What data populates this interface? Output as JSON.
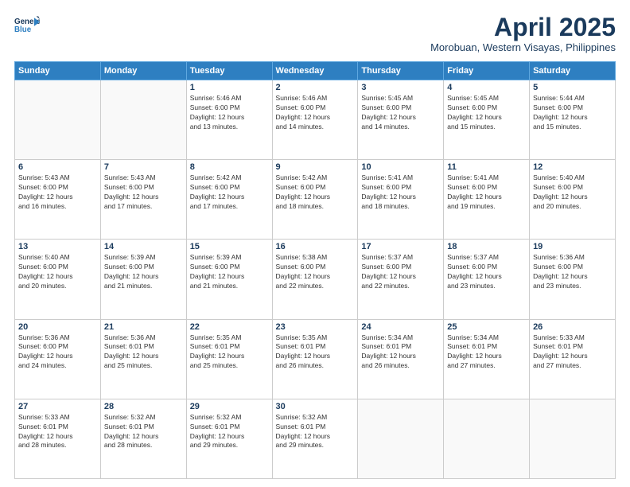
{
  "header": {
    "logo_line1": "General",
    "logo_line2": "Blue",
    "month": "April 2025",
    "location": "Morobuan, Western Visayas, Philippines"
  },
  "weekdays": [
    "Sunday",
    "Monday",
    "Tuesday",
    "Wednesday",
    "Thursday",
    "Friday",
    "Saturday"
  ],
  "weeks": [
    [
      {
        "day": "",
        "info": ""
      },
      {
        "day": "",
        "info": ""
      },
      {
        "day": "1",
        "info": "Sunrise: 5:46 AM\nSunset: 6:00 PM\nDaylight: 12 hours\nand 13 minutes."
      },
      {
        "day": "2",
        "info": "Sunrise: 5:46 AM\nSunset: 6:00 PM\nDaylight: 12 hours\nand 14 minutes."
      },
      {
        "day": "3",
        "info": "Sunrise: 5:45 AM\nSunset: 6:00 PM\nDaylight: 12 hours\nand 14 minutes."
      },
      {
        "day": "4",
        "info": "Sunrise: 5:45 AM\nSunset: 6:00 PM\nDaylight: 12 hours\nand 15 minutes."
      },
      {
        "day": "5",
        "info": "Sunrise: 5:44 AM\nSunset: 6:00 PM\nDaylight: 12 hours\nand 15 minutes."
      }
    ],
    [
      {
        "day": "6",
        "info": "Sunrise: 5:43 AM\nSunset: 6:00 PM\nDaylight: 12 hours\nand 16 minutes."
      },
      {
        "day": "7",
        "info": "Sunrise: 5:43 AM\nSunset: 6:00 PM\nDaylight: 12 hours\nand 17 minutes."
      },
      {
        "day": "8",
        "info": "Sunrise: 5:42 AM\nSunset: 6:00 PM\nDaylight: 12 hours\nand 17 minutes."
      },
      {
        "day": "9",
        "info": "Sunrise: 5:42 AM\nSunset: 6:00 PM\nDaylight: 12 hours\nand 18 minutes."
      },
      {
        "day": "10",
        "info": "Sunrise: 5:41 AM\nSunset: 6:00 PM\nDaylight: 12 hours\nand 18 minutes."
      },
      {
        "day": "11",
        "info": "Sunrise: 5:41 AM\nSunset: 6:00 PM\nDaylight: 12 hours\nand 19 minutes."
      },
      {
        "day": "12",
        "info": "Sunrise: 5:40 AM\nSunset: 6:00 PM\nDaylight: 12 hours\nand 20 minutes."
      }
    ],
    [
      {
        "day": "13",
        "info": "Sunrise: 5:40 AM\nSunset: 6:00 PM\nDaylight: 12 hours\nand 20 minutes."
      },
      {
        "day": "14",
        "info": "Sunrise: 5:39 AM\nSunset: 6:00 PM\nDaylight: 12 hours\nand 21 minutes."
      },
      {
        "day": "15",
        "info": "Sunrise: 5:39 AM\nSunset: 6:00 PM\nDaylight: 12 hours\nand 21 minutes."
      },
      {
        "day": "16",
        "info": "Sunrise: 5:38 AM\nSunset: 6:00 PM\nDaylight: 12 hours\nand 22 minutes."
      },
      {
        "day": "17",
        "info": "Sunrise: 5:37 AM\nSunset: 6:00 PM\nDaylight: 12 hours\nand 22 minutes."
      },
      {
        "day": "18",
        "info": "Sunrise: 5:37 AM\nSunset: 6:00 PM\nDaylight: 12 hours\nand 23 minutes."
      },
      {
        "day": "19",
        "info": "Sunrise: 5:36 AM\nSunset: 6:00 PM\nDaylight: 12 hours\nand 23 minutes."
      }
    ],
    [
      {
        "day": "20",
        "info": "Sunrise: 5:36 AM\nSunset: 6:00 PM\nDaylight: 12 hours\nand 24 minutes."
      },
      {
        "day": "21",
        "info": "Sunrise: 5:36 AM\nSunset: 6:01 PM\nDaylight: 12 hours\nand 25 minutes."
      },
      {
        "day": "22",
        "info": "Sunrise: 5:35 AM\nSunset: 6:01 PM\nDaylight: 12 hours\nand 25 minutes."
      },
      {
        "day": "23",
        "info": "Sunrise: 5:35 AM\nSunset: 6:01 PM\nDaylight: 12 hours\nand 26 minutes."
      },
      {
        "day": "24",
        "info": "Sunrise: 5:34 AM\nSunset: 6:01 PM\nDaylight: 12 hours\nand 26 minutes."
      },
      {
        "day": "25",
        "info": "Sunrise: 5:34 AM\nSunset: 6:01 PM\nDaylight: 12 hours\nand 27 minutes."
      },
      {
        "day": "26",
        "info": "Sunrise: 5:33 AM\nSunset: 6:01 PM\nDaylight: 12 hours\nand 27 minutes."
      }
    ],
    [
      {
        "day": "27",
        "info": "Sunrise: 5:33 AM\nSunset: 6:01 PM\nDaylight: 12 hours\nand 28 minutes."
      },
      {
        "day": "28",
        "info": "Sunrise: 5:32 AM\nSunset: 6:01 PM\nDaylight: 12 hours\nand 28 minutes."
      },
      {
        "day": "29",
        "info": "Sunrise: 5:32 AM\nSunset: 6:01 PM\nDaylight: 12 hours\nand 29 minutes."
      },
      {
        "day": "30",
        "info": "Sunrise: 5:32 AM\nSunset: 6:01 PM\nDaylight: 12 hours\nand 29 minutes."
      },
      {
        "day": "",
        "info": ""
      },
      {
        "day": "",
        "info": ""
      },
      {
        "day": "",
        "info": ""
      }
    ]
  ]
}
